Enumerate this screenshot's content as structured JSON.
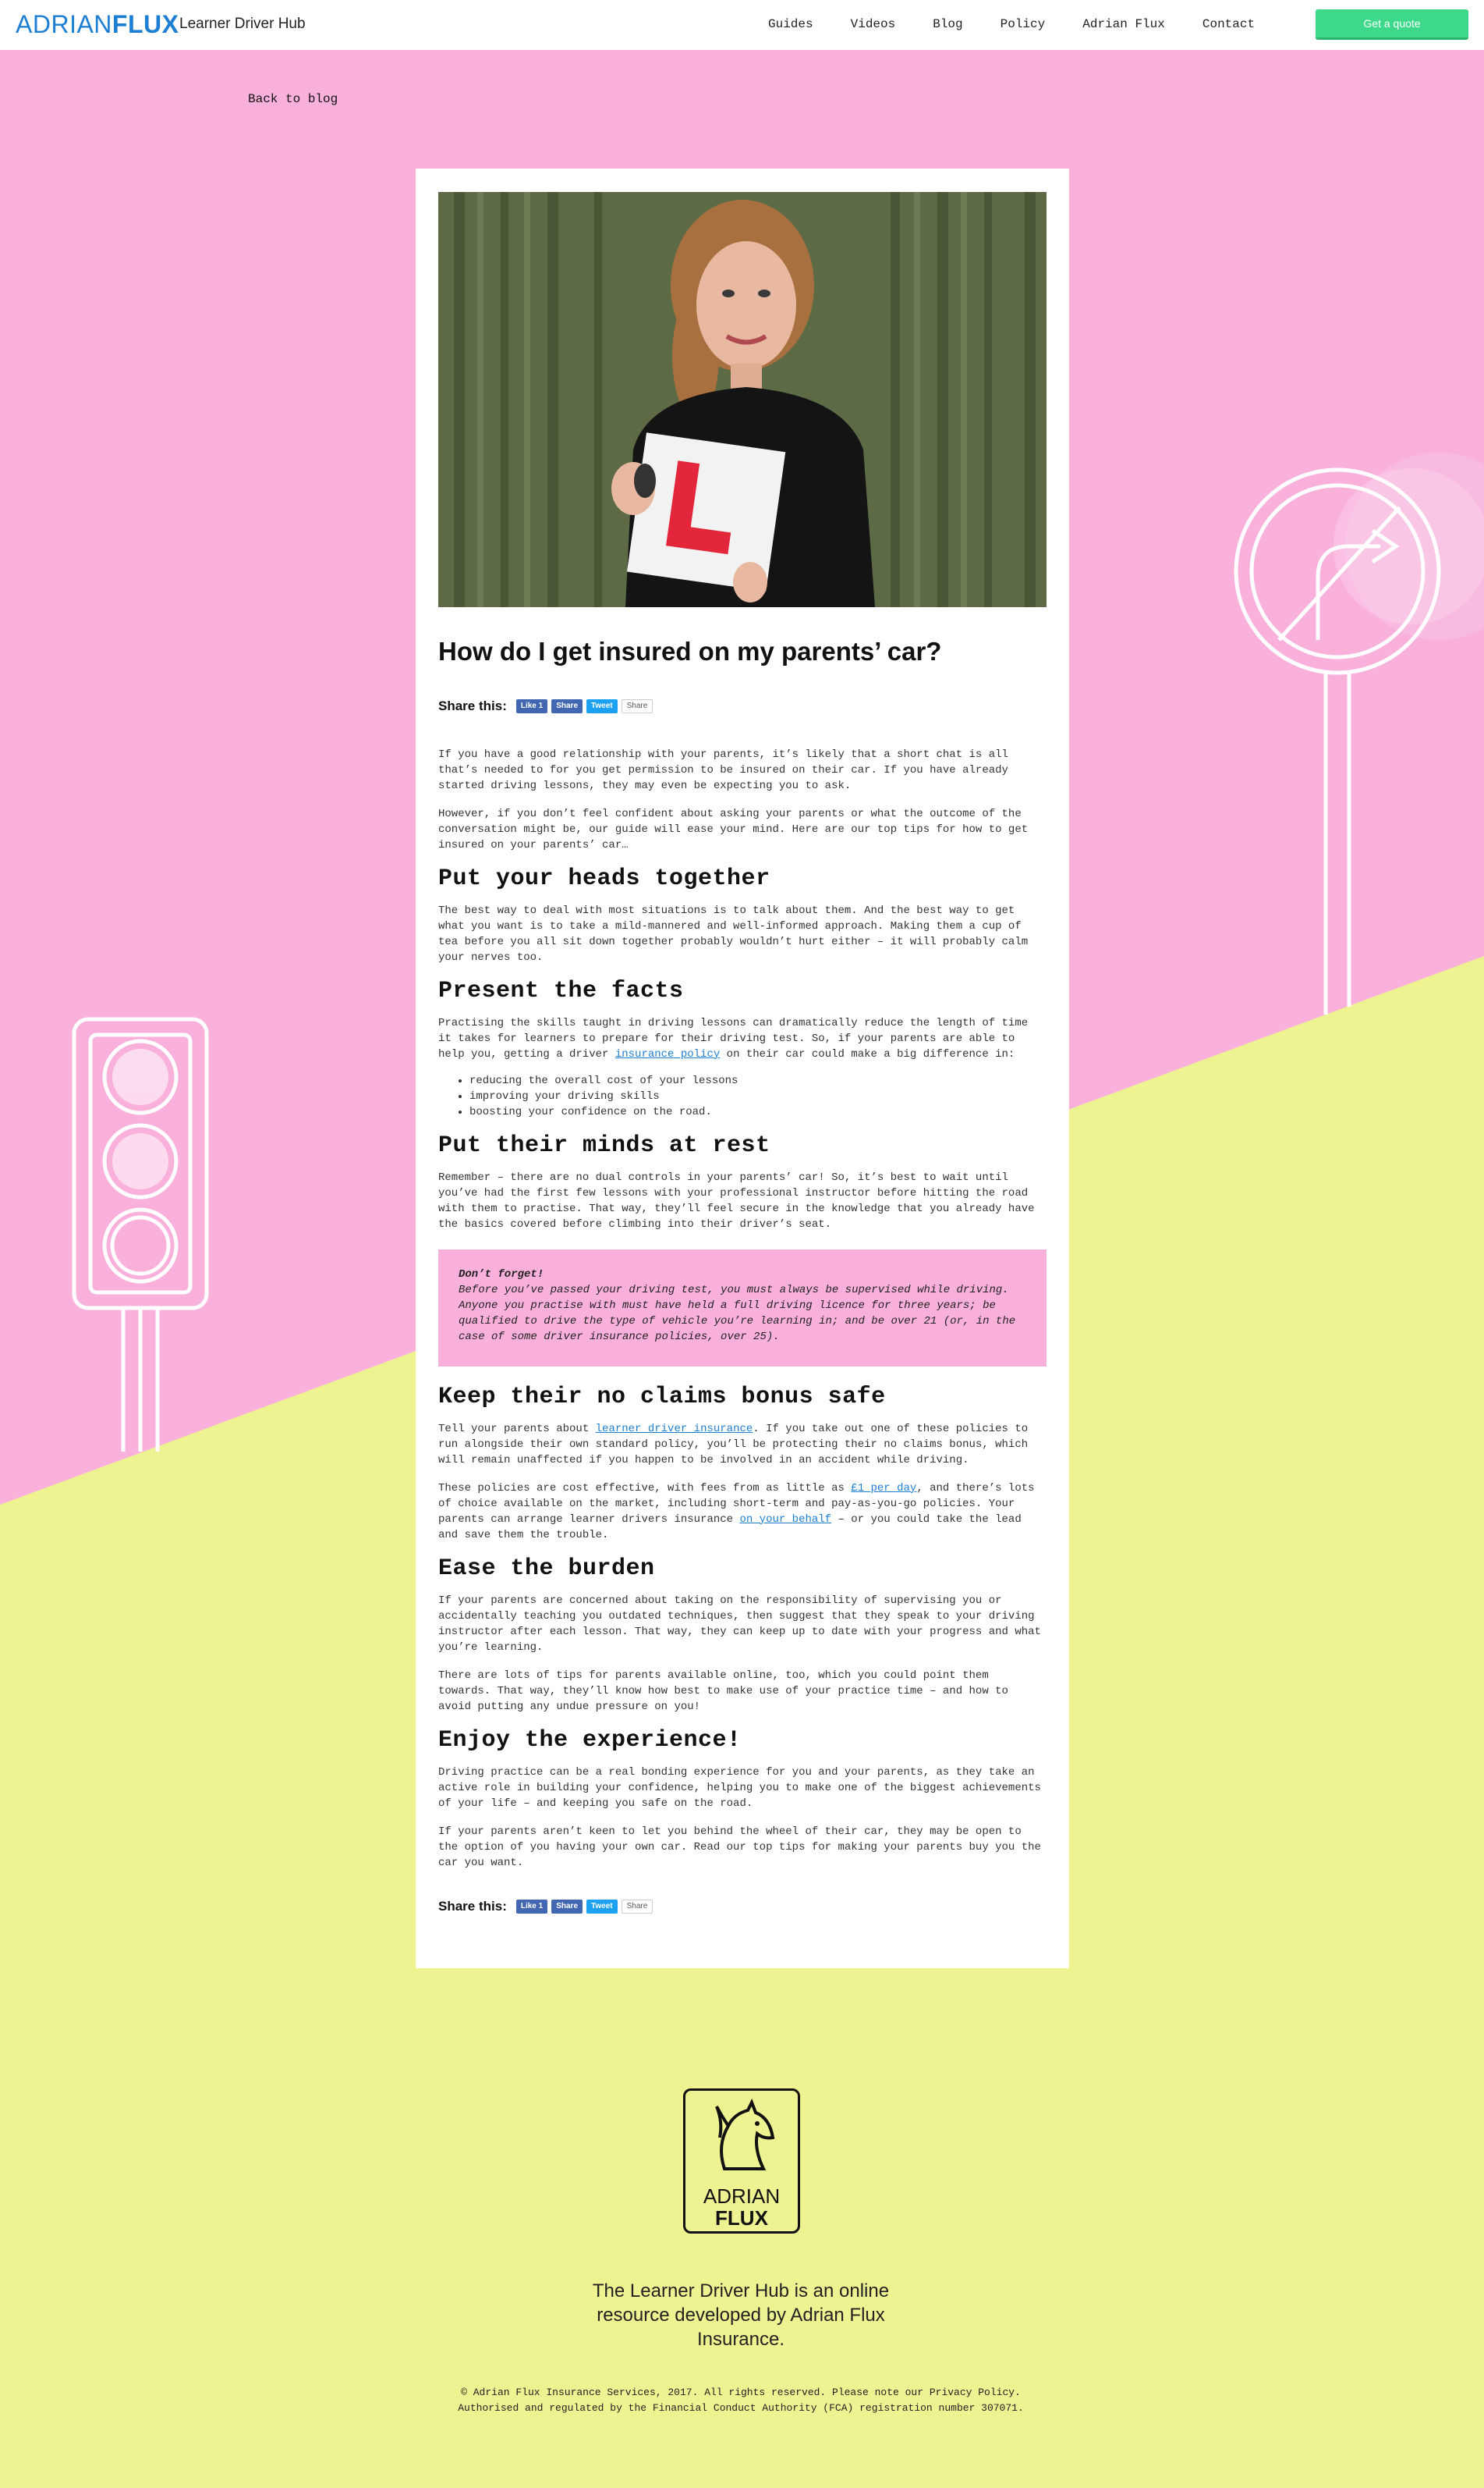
{
  "colors": {
    "pink": "#f9b1dc",
    "yellow": "#eef392",
    "brand_blue": "#1d7fd3",
    "cta_green": "#3dd88a"
  },
  "header": {
    "logo_part1": "ADRIAN",
    "logo_part2": "FLUX",
    "hub_name": "Learner Driver Hub",
    "nav": [
      "Guides",
      "Videos",
      "Blog",
      "Policy",
      "Adrian Flux",
      "Contact"
    ],
    "cta": "Get a quote"
  },
  "back_link": "Back to blog",
  "article": {
    "title": "How do I get insured on my parents’ car?",
    "share": {
      "label": "Share this:",
      "fb_like": "Like 1",
      "fb_share": "Share",
      "tweet": "Tweet",
      "gplus": "Share"
    },
    "intro1": "If you have a good relationship with your parents, it’s likely that a short chat is all that’s needed to for you get permission to be insured on their car. If you have already started driving lessons, they may even be expecting you to ask.",
    "intro2": "However, if you don’t feel confident about asking your parents or what the outcome of the conversation might be, our guide will ease your mind. Here are our top tips for how to get insured on your parents’ car…",
    "s1_title": "Put your heads together",
    "s1_p1": "The best way to deal with most situations is to talk about them. And the best way to get what you want is to take a mild-mannered and well-informed approach. Making them a cup of tea before you all sit down together probably wouldn’t hurt either – it will probably calm your nerves too.",
    "s2_title": "Present the facts",
    "s2_p1_a": "Practising the skills taught in driving lessons can dramatically reduce the length of time it takes for learners to prepare for their driving test. So, if your parents are able to help you, getting a driver ",
    "s2_p1_link": "insurance policy",
    "s2_p1_b": " on their car could make a big difference in:",
    "s2_bullets": [
      "reducing the overall cost of your lessons",
      "improving your driving skills",
      "boosting your confidence on the road."
    ],
    "s3_title": "Put their minds at rest",
    "s3_p1": "Remember – there are no dual controls in your parents’ car! So, it’s best to wait until you’ve had the first few lessons with your professional instructor before hitting the road with them to practise. That way, they’ll feel secure in the knowledge that you already have the basics covered before climbing into their driver’s seat.",
    "callout_title": "Don’t forget!",
    "callout_text": "Before you’ve passed your driving test, you must always be supervised while driving. Anyone you practise with must have held a full driving licence for three years; be qualified to drive the type of vehicle you’re learning in; and be over 21 (or, in the case of some driver insurance policies, over 25).",
    "s4_title": "Keep their no claims bonus safe",
    "s4_p1_a": "Tell your parents about ",
    "s4_p1_link": "learner driver insurance",
    "s4_p1_b": ". If you take out one of these policies to run alongside their own standard policy, you’ll be protecting their no claims bonus, which will remain unaffected if you happen to be involved in an accident while driving.",
    "s4_p2_a": "These policies are cost effective, with fees from as little as ",
    "s4_p2_link1": "£1 per day",
    "s4_p2_b": ", and there’s lots of choice available on the market, including short-term and pay-as-you-go policies. Your parents can arrange learner drivers insurance ",
    "s4_p2_link2": "on your behalf",
    "s4_p2_c": " – or you could take the lead and save them the trouble.",
    "s5_title": "Ease the burden",
    "s5_p1": "If your parents are concerned about taking on the responsibility of supervising you or accidentally teaching you outdated techniques, then suggest that they speak to your driving instructor after each lesson. That way, they can keep up to date with your progress and what you’re learning.",
    "s5_p2": "There are lots of tips for parents available online, too, which you could point them towards. That way, they’ll know how best to make use of your practice time – and how to avoid putting any undue pressure on you!",
    "s6_title": "Enjoy the experience!",
    "s6_p1": "Driving practice can be a real bonding experience for you and your parents, as they take an active role in building your confidence, helping you to make one of the biggest achievements of your life – and keeping you safe on the road.",
    "s6_p2": "If your parents aren’t keen to let you behind the wheel of their car, they may be open to the option of you having your own car. Read our top tips for making your parents buy you the car you want."
  },
  "footer": {
    "logo_line1": "ADRIAN",
    "logo_line2": "FLUX",
    "tagline": "The Learner Driver Hub is an online resource developed by Adrian Flux Insurance.",
    "copyright1": "© Adrian Flux Insurance Services, 2017. All rights reserved. Please note our Privacy Policy.",
    "copyright2": "Authorised and regulated by the Financial Conduct Authority (FCA) registration number 307071."
  }
}
